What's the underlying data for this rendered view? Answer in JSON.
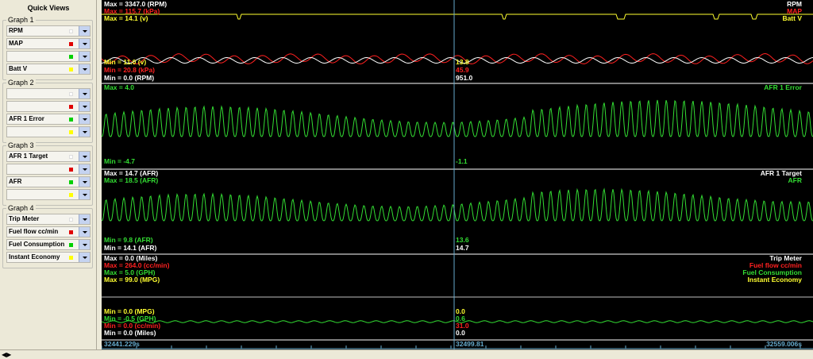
{
  "sidebar": {
    "title": "Quick Views",
    "groups": [
      {
        "label": "Graph 1",
        "items": [
          {
            "text": "RPM",
            "swatch": "#ffffff"
          },
          {
            "text": "MAP",
            "swatch": "#e00000"
          },
          {
            "text": "",
            "swatch": "#00d000"
          },
          {
            "text": "Batt V",
            "swatch": "#ffff00"
          }
        ]
      },
      {
        "label": "Graph 2",
        "items": [
          {
            "text": "",
            "swatch": "#ffffff"
          },
          {
            "text": "",
            "swatch": "#e00000"
          },
          {
            "text": "AFR 1 Error",
            "swatch": "#00d000"
          },
          {
            "text": "",
            "swatch": "#ffff00"
          }
        ]
      },
      {
        "label": "Graph 3",
        "items": [
          {
            "text": "AFR 1 Target",
            "swatch": "#ffffff"
          },
          {
            "text": "",
            "swatch": "#e00000"
          },
          {
            "text": "AFR",
            "swatch": "#00d000"
          },
          {
            "text": "",
            "swatch": "#ffff00"
          }
        ]
      },
      {
        "label": "Graph 4",
        "items": [
          {
            "text": "Trip Meter",
            "swatch": "#ffffff"
          },
          {
            "text": "Fuel flow cc/min",
            "swatch": "#e00000"
          },
          {
            "text": "Fuel Consumption",
            "swatch": "#00d000"
          },
          {
            "text": "Instant Economy",
            "swatch": "#ffff00"
          }
        ]
      }
    ]
  },
  "colors": {
    "white": "#ffffff",
    "red": "#ff2020",
    "green": "#33dd33",
    "yellow": "#ffff30",
    "cursor": "#66aacc"
  },
  "panels": [
    {
      "max_labels": [
        {
          "text": "Max = 3347.0 (RPM)",
          "color": "#ffffff"
        },
        {
          "text": "Max = 115.7 (kPa)",
          "color": "#ff2020"
        },
        {
          "text": "Max = 14.1 (v)",
          "color": "#ffff30"
        }
      ],
      "min_labels": [
        {
          "text": "Min = 11.0 (v)",
          "color": "#ffff30"
        },
        {
          "text": "Min = 20.8 (kPa)",
          "color": "#ff2020"
        },
        {
          "text": "Min = 0.0 (RPM)",
          "color": "#ffffff"
        }
      ],
      "right_labels": [
        {
          "text": "RPM",
          "color": "#ffffff"
        },
        {
          "text": "MAP",
          "color": "#ff2020"
        },
        {
          "text": "Batt V",
          "color": "#ffff30"
        }
      ],
      "cursor_values": [
        {
          "text": "13.8",
          "color": "#ffff30"
        },
        {
          "text": "45.9",
          "color": "#ff2020"
        },
        {
          "text": "951.0",
          "color": "#ffffff"
        }
      ]
    },
    {
      "max_labels": [
        {
          "text": "Max = 4.0",
          "color": "#33dd33"
        }
      ],
      "min_labels": [
        {
          "text": "Min = -4.7",
          "color": "#33dd33"
        }
      ],
      "right_labels": [
        {
          "text": "AFR 1 Error",
          "color": "#33dd33"
        }
      ],
      "cursor_values": [
        {
          "text": "-1.1",
          "color": "#33dd33"
        }
      ]
    },
    {
      "max_labels": [
        {
          "text": "Max = 14.7 (AFR)",
          "color": "#ffffff"
        },
        {
          "text": "Max = 18.5 (AFR)",
          "color": "#33dd33"
        }
      ],
      "min_labels": [
        {
          "text": "Min = 9.8 (AFR)",
          "color": "#33dd33"
        },
        {
          "text": "Min = 14.1 (AFR)",
          "color": "#ffffff"
        }
      ],
      "right_labels": [
        {
          "text": "AFR 1 Target",
          "color": "#ffffff"
        },
        {
          "text": "AFR",
          "color": "#33dd33"
        }
      ],
      "cursor_values": [
        {
          "text": "13.6",
          "color": "#33dd33"
        },
        {
          "text": "14.7",
          "color": "#ffffff"
        }
      ]
    },
    {
      "max_labels": [
        {
          "text": "Max = 0.0 (Miles)",
          "color": "#ffffff"
        },
        {
          "text": "Max = 264.0 (cc/min)",
          "color": "#ff2020"
        },
        {
          "text": "Max = 5.0 (GPH)",
          "color": "#33dd33"
        },
        {
          "text": "Max = 99.0 (MPG)",
          "color": "#ffff30"
        }
      ],
      "min_labels": [
        {
          "text": "Min = 0.0 (MPG)",
          "color": "#ffff30"
        },
        {
          "text": "Min = -0.5 (GPH)",
          "color": "#33dd33"
        },
        {
          "text": "Min = 0.0 (cc/min)",
          "color": "#ff2020"
        },
        {
          "text": "Min = 0.0 (Miles)",
          "color": "#ffffff"
        }
      ],
      "right_labels": [
        {
          "text": "Trip Meter",
          "color": "#ffffff"
        },
        {
          "text": "Fuel flow cc/min",
          "color": "#ff2020"
        },
        {
          "text": "Fuel Consumption",
          "color": "#33dd33"
        },
        {
          "text": "Instant Economy",
          "color": "#ffff30"
        }
      ],
      "cursor_values": [
        {
          "text": "0.0",
          "color": "#ffff30"
        },
        {
          "text": "0.6",
          "color": "#33dd33"
        },
        {
          "text": "31.0",
          "color": "#ff2020"
        },
        {
          "text": "0.0",
          "color": "#ffffff"
        }
      ]
    }
  ],
  "timeline": {
    "start": "32441.229s",
    "cursor": "32499.81",
    "end": "32559.006s"
  }
}
